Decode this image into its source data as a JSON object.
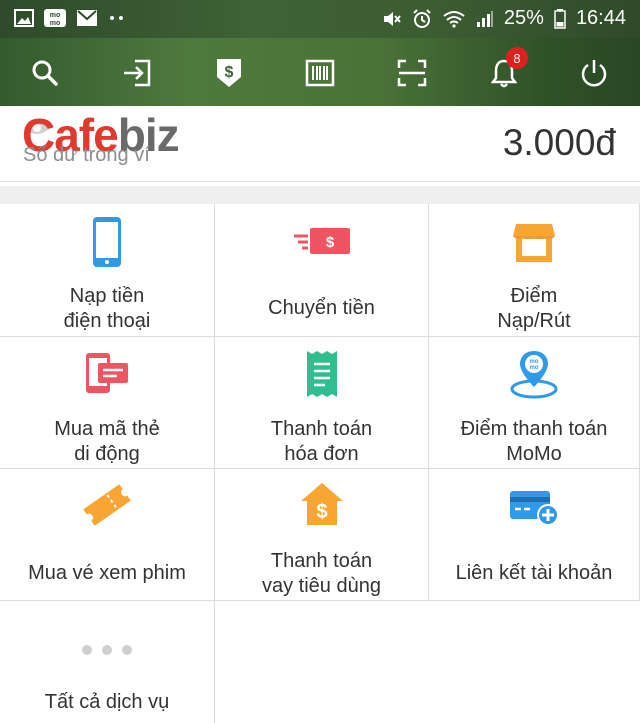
{
  "status_bar": {
    "icons_left": [
      "image-icon",
      "momo-icon",
      "mail-icon",
      "more-dots-icon"
    ],
    "icons_right": [
      "mute-icon",
      "alarm-icon",
      "wifi-icon",
      "signal-icon",
      "battery-icon"
    ],
    "battery": "25%",
    "time": "16:44"
  },
  "toolbar": {
    "icons": [
      "search-icon",
      "login-icon",
      "wallet-shield-icon",
      "barcode-icon",
      "scan-icon",
      "bell-icon",
      "power-icon"
    ],
    "notification_count": "8",
    "wallet_symbol": "$"
  },
  "balance": {
    "brand_prefix": "Cafe",
    "brand_suffix": "biz",
    "label": "Số dư trong ví",
    "amount": "3.000đ"
  },
  "services": [
    {
      "line1": "Nạp tiền",
      "line2": "điện thoại",
      "icon": "phone-icon",
      "color": "#2f9be8"
    },
    {
      "line1": "Chuyển tiền",
      "line2": "",
      "icon": "transfer-money-icon",
      "color": "#ef5561"
    },
    {
      "line1": "Điểm",
      "line2": "Nạp/Rút",
      "icon": "store-icon",
      "color": "#f7a533"
    },
    {
      "line1": "Mua mã thẻ",
      "line2": "di động",
      "icon": "mobile-card-icon",
      "color": "#ef5561"
    },
    {
      "line1": "Thanh toán",
      "line2": "hóa đơn",
      "icon": "bill-icon",
      "color": "#2fbf8f"
    },
    {
      "line1": "Điểm thanh toán",
      "line2": "MoMo",
      "icon": "momo-location-icon",
      "color": "#2f9be8"
    },
    {
      "line1": "Mua vé xem phim",
      "line2": "",
      "icon": "movie-ticket-icon",
      "color": "#f7a533"
    },
    {
      "line1": "Thanh toán",
      "line2": "vay tiêu dùng",
      "icon": "loan-house-icon",
      "color": "#f7a533"
    },
    {
      "line1": "Liên kết tài khoản",
      "line2": "",
      "icon": "link-card-icon",
      "color": "#2f9be8"
    },
    {
      "line1": "Tất cả dịch vụ",
      "line2": "",
      "icon": "more-dots-icon",
      "color": "#cfcfcf"
    }
  ]
}
